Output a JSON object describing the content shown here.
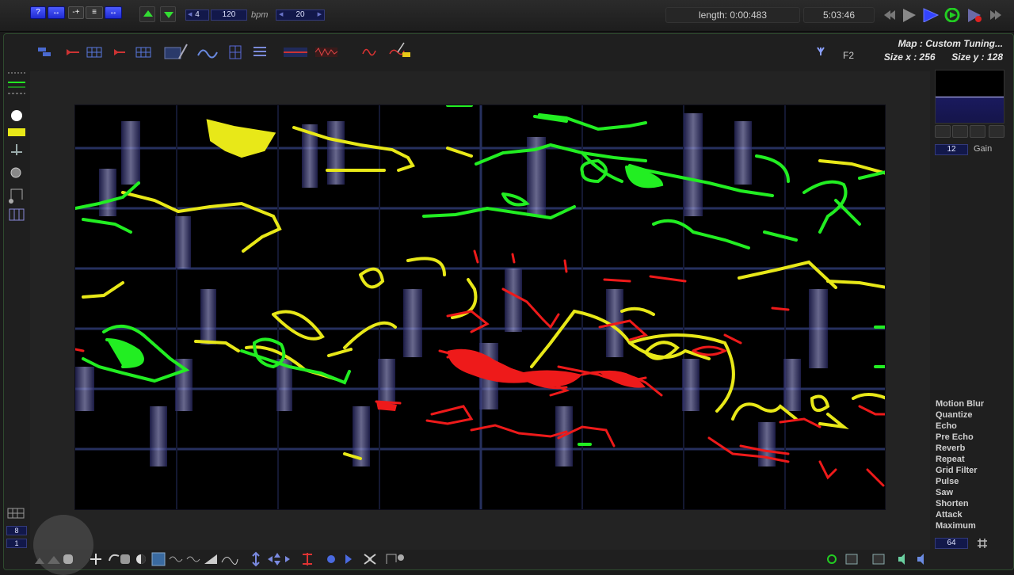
{
  "topbar": {
    "numbox1": "4",
    "tempo": "120",
    "tempo_unit": "bpm",
    "numbox2": "20",
    "length": "length: 0:00:483",
    "time": "5:03:46"
  },
  "map": {
    "title": "Map : Custom Tuning...",
    "size_x": "Size x : 256",
    "size_y": "Size y : 128",
    "shortcut": "F2"
  },
  "right_panel": {
    "gain_value": "12",
    "gain_label": "Gain",
    "effects": [
      "Motion Blur",
      "Quantize",
      "Echo",
      "Pre Echo",
      "Reverb",
      "Repeat",
      "Grid Filter",
      "Pulse",
      "Saw",
      "Shorten",
      "Attack",
      "Maximum"
    ],
    "bottom_value": "64"
  },
  "left_panel": {
    "num_top": "8",
    "num_bottom": "1"
  },
  "colors": {
    "green": "#22ee22",
    "yellow": "#e8e818",
    "red": "#ee1a1a",
    "grid": "#2a2f5a",
    "accent_blue": "#2a35e0"
  },
  "icons": {
    "transport": [
      "rewind-icon",
      "play-icon",
      "play-blue-icon",
      "loop-icon",
      "record-play-icon",
      "fast-forward-icon"
    ]
  }
}
